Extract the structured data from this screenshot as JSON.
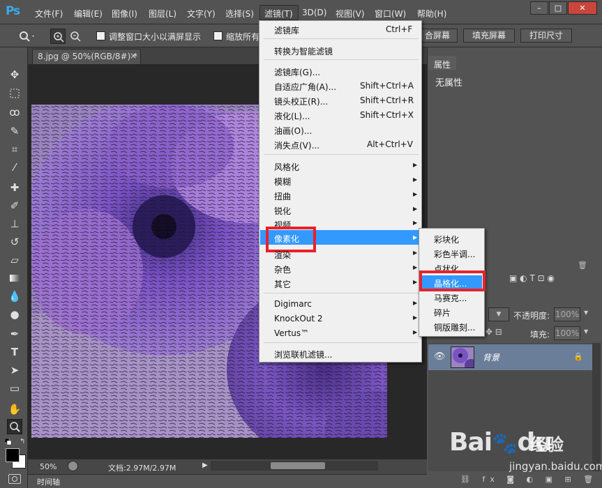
{
  "app": {
    "logo": "Ps"
  },
  "menubar": {
    "items": [
      "文件(F)",
      "编辑(E)",
      "图像(I)",
      "图层(L)",
      "文字(Y)",
      "选择(S)",
      "滤镜(T)",
      "3D(D)",
      "视图(V)",
      "窗口(W)",
      "帮助(H)"
    ],
    "window_controls": [
      "–",
      "□",
      "✕"
    ]
  },
  "options": {
    "resize_label": "调整窗口大小以满屏显示",
    "zoom_all_label": "缩放所有",
    "fit_label": "合屏幕",
    "fill_label": "填充屏幕",
    "print_label": "打印尺寸"
  },
  "document": {
    "tab_label": "8.jpg @ 50%(RGB/8#) *",
    "close_glyph": "×",
    "zoom": "50%",
    "doc_info": "文档:2.97M/2.97M",
    "timeline_label": "时间轴"
  },
  "properties": {
    "tab_label": "属性",
    "empty_label": "无属性"
  },
  "layers": {
    "opacity_label": "不透明度:",
    "opacity_value": "100%",
    "fill_label": "填充:",
    "fill_value": "100%",
    "layer_name": "背景"
  },
  "filter_menu": {
    "items": [
      {
        "label": "滤镜库",
        "shortcut": "Ctrl+F"
      },
      {
        "label": "转换为智能滤镜",
        "shortcut": ""
      },
      {
        "label": "滤镜库(G)...",
        "shortcut": ""
      },
      {
        "label": "自适应广角(A)...",
        "shortcut": "Shift+Ctrl+A"
      },
      {
        "label": "镜头校正(R)...",
        "shortcut": "Shift+Ctrl+R"
      },
      {
        "label": "液化(L)...",
        "shortcut": "Shift+Ctrl+X"
      },
      {
        "label": "油画(O)...",
        "shortcut": ""
      },
      {
        "label": "消失点(V)...",
        "shortcut": "Alt+Ctrl+V"
      },
      {
        "label": "风格化",
        "shortcut": ""
      },
      {
        "label": "模糊",
        "shortcut": ""
      },
      {
        "label": "扭曲",
        "shortcut": ""
      },
      {
        "label": "锐化",
        "shortcut": ""
      },
      {
        "label": "视频",
        "shortcut": ""
      },
      {
        "label": "像素化",
        "shortcut": ""
      },
      {
        "label": "渲染",
        "shortcut": ""
      },
      {
        "label": "杂色",
        "shortcut": ""
      },
      {
        "label": "其它",
        "shortcut": ""
      },
      {
        "label": "Digimarc",
        "shortcut": ""
      },
      {
        "label": "KnockOut 2",
        "shortcut": ""
      },
      {
        "label": "Vertus™",
        "shortcut": ""
      },
      {
        "label": "浏览联机滤镜...",
        "shortcut": ""
      }
    ]
  },
  "pixelate_submenu": {
    "items": [
      "彩块化",
      "彩色半调...",
      "点状化...",
      "晶格化...",
      "马赛克...",
      "碎片",
      "铜版雕刻..."
    ]
  },
  "watermark": {
    "brand": "Bai",
    "brand2": "du",
    "brand_cn": "经验",
    "url": "jingyan.baidu.com"
  },
  "colors": {
    "accent": "#3399ff",
    "highlight_box": "#e8222a",
    "ps_logo": "#3aa9e8"
  }
}
